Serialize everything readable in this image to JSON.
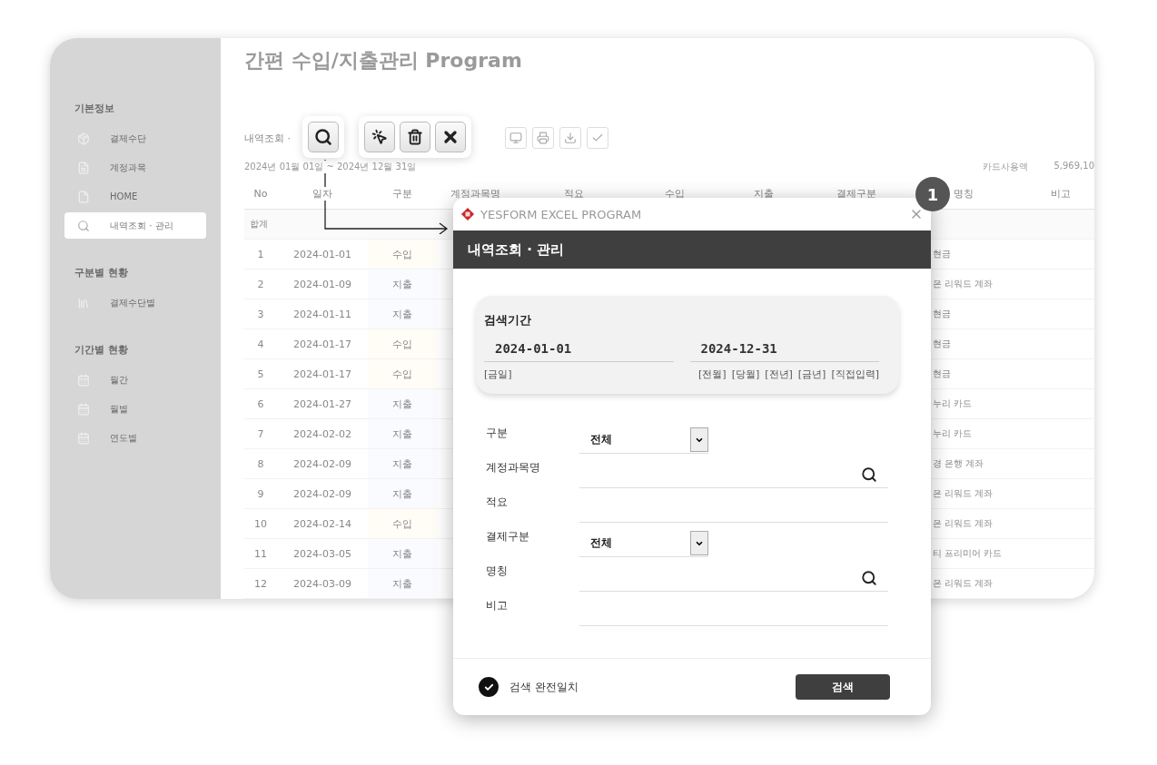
{
  "app": {
    "title": "간편 수입/지출관리 Program",
    "breadcrumb": "내역조회 ·",
    "period": "2024년 01월 01일 ~ 2024년 12월 31일",
    "summary_label": "카드사용액",
    "summary_value": "5,969,10"
  },
  "sidebar": {
    "sections": [
      {
        "title": "기본정보",
        "items": [
          {
            "label": "결제수단",
            "selected": false
          },
          {
            "label": "계정과목",
            "selected": false
          },
          {
            "label": "HOME",
            "selected": false
          },
          {
            "label": "내역조회 · 관리",
            "selected": true
          }
        ]
      },
      {
        "title": "구분별 현황",
        "items": [
          {
            "label": "결제수단별",
            "selected": false
          }
        ]
      },
      {
        "title": "기간별 현황",
        "items": [
          {
            "label": "월간",
            "selected": false
          },
          {
            "label": "월별",
            "selected": false
          },
          {
            "label": "연도별",
            "selected": false
          }
        ]
      }
    ]
  },
  "table": {
    "columns": [
      "No",
      "일자",
      "구분",
      "계정과목명",
      "적요",
      "수입",
      "지출",
      "결제구분",
      "명칭",
      "비고"
    ],
    "total_label": "합계",
    "rows": [
      {
        "no": "1",
        "date": "2024-01-01",
        "type": "수입",
        "kind": "income",
        "name": "현금"
      },
      {
        "no": "2",
        "date": "2024-01-09",
        "type": "지출",
        "kind": "expense",
        "name": "은 리워드 계좌"
      },
      {
        "no": "3",
        "date": "2024-01-11",
        "type": "지출",
        "kind": "expense",
        "name": "현금"
      },
      {
        "no": "4",
        "date": "2024-01-17",
        "type": "수입",
        "kind": "income",
        "name": "현금"
      },
      {
        "no": "5",
        "date": "2024-01-17",
        "type": "수입",
        "kind": "income",
        "name": "현금"
      },
      {
        "no": "6",
        "date": "2024-01-27",
        "type": "지출",
        "kind": "expense",
        "name": "누리 카드"
      },
      {
        "no": "7",
        "date": "2024-02-02",
        "type": "지출",
        "kind": "expense",
        "name": "누리 카드"
      },
      {
        "no": "8",
        "date": "2024-02-09",
        "type": "지출",
        "kind": "expense",
        "name": "경 은행 계좌"
      },
      {
        "no": "9",
        "date": "2024-02-09",
        "type": "지출",
        "kind": "expense",
        "name": "은 리워드 계좌"
      },
      {
        "no": "10",
        "date": "2024-02-14",
        "type": "수입",
        "kind": "income",
        "name": "은 리워드 계좌"
      },
      {
        "no": "11",
        "date": "2024-03-05",
        "type": "지출",
        "kind": "expense",
        "name": "티 프리미어 카드"
      },
      {
        "no": "12",
        "date": "2024-03-09",
        "type": "지출",
        "kind": "expense",
        "name": "은 리워드 계좌"
      }
    ]
  },
  "callout": {
    "number": "1"
  },
  "dialog": {
    "window_title": "YESFORM EXCEL PROGRAM",
    "header": "내역조회 · 관리",
    "period": {
      "title": "검색기간",
      "start": "2024-01-01",
      "end": "2024-12-31",
      "left_links": [
        "[금일]"
      ],
      "right_links": [
        "[전월]",
        "[당월]",
        "[전년]",
        "[금년]",
        "[직접입력]"
      ]
    },
    "fields": [
      {
        "label": "구분",
        "kind": "select",
        "value": "전체"
      },
      {
        "label": "계정과목명",
        "kind": "search"
      },
      {
        "label": "적요",
        "kind": "text"
      },
      {
        "label": "결제구분",
        "kind": "select",
        "value": "전체"
      },
      {
        "label": "명칭",
        "kind": "search"
      },
      {
        "label": "비고",
        "kind": "text"
      }
    ],
    "exact_match": {
      "label": "검색 완전일치",
      "checked": true
    },
    "search_button": "검색"
  }
}
